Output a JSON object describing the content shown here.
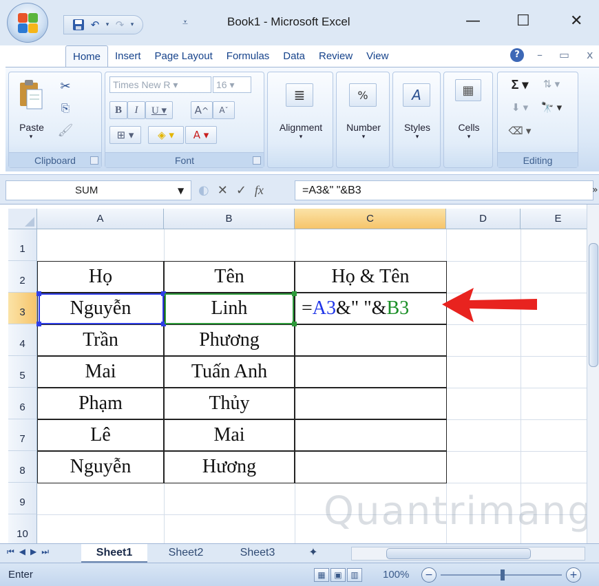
{
  "window": {
    "title": "Book1 - Microsoft Excel",
    "controls": {
      "minimize": "—",
      "maximize": "☐",
      "close": "✕"
    }
  },
  "quick_access": {
    "save_icon": "save-icon",
    "undo_icon": "undo-icon",
    "redo_icon": "redo-icon"
  },
  "tabs": [
    "Home",
    "Insert",
    "Page Layout",
    "Formulas",
    "Data",
    "Review",
    "View"
  ],
  "active_tab": "Home",
  "ribbon": {
    "clipboard": {
      "label": "Clipboard",
      "paste": "Paste"
    },
    "font": {
      "label": "Font",
      "font_name": "Times New R",
      "font_size": "16"
    },
    "alignment": {
      "label": "Alignment"
    },
    "number": {
      "label": "Number"
    },
    "styles": {
      "label": "Styles"
    },
    "cells": {
      "label": "Cells"
    },
    "editing": {
      "label": "Editing"
    }
  },
  "formula_bar": {
    "name_box": "SUM",
    "formula": "=A3&\" \"&B3",
    "fx": "fx"
  },
  "columns": [
    "A",
    "B",
    "C",
    "D",
    "E"
  ],
  "active_column": "C",
  "rows": [
    "1",
    "2",
    "3",
    "4",
    "5",
    "6",
    "7",
    "8",
    "9",
    "10"
  ],
  "active_row": "3",
  "table": {
    "header": [
      "Họ",
      "Tên",
      "Họ & Tên"
    ],
    "data": [
      [
        "Nguyễn",
        "Linh"
      ],
      [
        "Trần",
        "Phương"
      ],
      [
        "Mai",
        "Tuấn Anh"
      ],
      [
        "Phạm",
        "Thủy"
      ],
      [
        "Lê",
        "Mai"
      ],
      [
        "Nguyễn",
        "Hương"
      ]
    ]
  },
  "editing_cell": {
    "prefix": "=",
    "ref1": "A3",
    "mid": "&\" \"&",
    "ref2": "B3"
  },
  "sheets": [
    "Sheet1",
    "Sheet2",
    "Sheet3"
  ],
  "active_sheet": "Sheet1",
  "status": {
    "mode": "Enter",
    "zoom": "100%"
  },
  "watermark": "Quantrimang",
  "colors": {
    "ref_blue": "#1f35e8",
    "ref_green": "#1a8f26",
    "arrow_red": "#e8231f",
    "header_active": "#f6c46b"
  }
}
